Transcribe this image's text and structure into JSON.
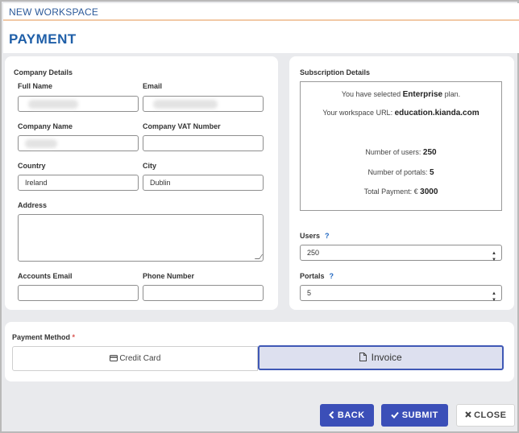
{
  "window": {
    "title": "NEW WORKSPACE"
  },
  "page": {
    "title": "PAYMENT"
  },
  "company": {
    "section_title": "Company Details",
    "full_name_label": "Full Name",
    "email_label": "Email",
    "company_name_label": "Company Name",
    "vat_label": "Company VAT Number",
    "country_label": "Country",
    "country_value": "Ireland",
    "city_label": "City",
    "city_value": "Dublin",
    "address_label": "Address",
    "accounts_email_label": "Accounts Email",
    "phone_label": "Phone Number"
  },
  "subscription": {
    "section_title": "Subscription Details",
    "selected_prefix": "You have selected",
    "plan_name": "Enterprise",
    "selected_suffix": "plan.",
    "url_label": "Your workspace URL:",
    "url_value": "education.kianda.com",
    "users_label": "Number of users:",
    "users_value": "250",
    "portals_label": "Number of portals:",
    "portals_value": "5",
    "total_label": "Total Payment: €",
    "total_value": "3000"
  },
  "users_input": {
    "label": "Users",
    "help": "?",
    "value": "250"
  },
  "portals_input": {
    "label": "Portals",
    "help": "?",
    "value": "5"
  },
  "payment": {
    "label": "Payment Method",
    "required_mark": "*",
    "credit_card_label": "Credit Card",
    "invoice_label": "Invoice",
    "selected": "Invoice"
  },
  "buttons": {
    "back": "BACK",
    "submit": "SUBMIT",
    "close": "CLOSE"
  },
  "icons": {
    "credit_card": "credit-card-icon",
    "invoice": "document-icon",
    "back": "chevron-left-icon",
    "submit": "check-icon",
    "close": "close-icon"
  },
  "colors": {
    "accent": "#3b4fb8",
    "title": "#1f5fa8",
    "required": "#d9534f",
    "help": "#1f66c1"
  }
}
